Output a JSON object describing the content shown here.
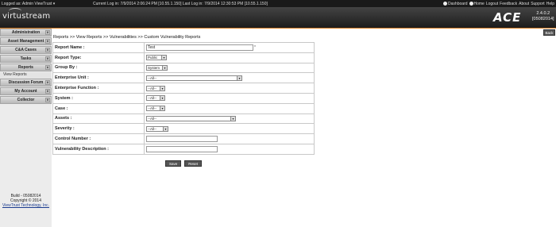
{
  "topbar": {
    "logged_as": "Logged as: Admin ViewTrust ▾",
    "last_login": "Current Log in: 7/9/2014 2:06:24 PM [10.55.1.150]   Last Log in: 7/9/2014 12:30:53 PM [10.55.1.150]",
    "links": [
      "Dashboard",
      "Home",
      "Logout",
      "Feedback",
      "About",
      "Support",
      "Help"
    ]
  },
  "header": {
    "logo": "virtustream",
    "product": "ACE",
    "version": "2.4.0.2",
    "build_tag": "[05082014]"
  },
  "sidebar": {
    "items": [
      "Administration",
      "Asset Management",
      "C&A Cases",
      "Tasks",
      "Reports"
    ],
    "sub_item": "View Reports",
    "items2": [
      "Discussion Forum",
      "My Account",
      "Collector"
    ],
    "build": "Build - 05082014",
    "copyright": "Copyright © 2014",
    "company": "ViewTrust Technology, Inc."
  },
  "main": {
    "back": "Back",
    "breadcrumb": "Reports >> View Reports >> Vulnerabilities >> Custom Vulnerability Reports",
    "form": {
      "report_name_label": "Report Name :",
      "report_name_value": "Test",
      "report_type_label": "Report Type:",
      "report_type_value": "Public",
      "group_by_label": "Group By :",
      "group_by_value": "System",
      "enterprise_unit_label": "Enterprise Unit :",
      "enterprise_unit_value": "--All--",
      "enterprise_function_label": "Enterprise Function :",
      "enterprise_function_value": "--All--",
      "system_label": "System :",
      "system_value": "--All--",
      "case_label": "Case :",
      "case_value": "--All--",
      "assets_label": "Assets :",
      "assets_value": "--All--",
      "severity_label": "Severity :",
      "severity_value": "--All--",
      "control_number_label": "Control Number :",
      "control_number_value": "",
      "vuln_desc_label": "Vulnerability Description :",
      "vuln_desc_value": ""
    },
    "save": "Save",
    "reset": "Reset"
  }
}
